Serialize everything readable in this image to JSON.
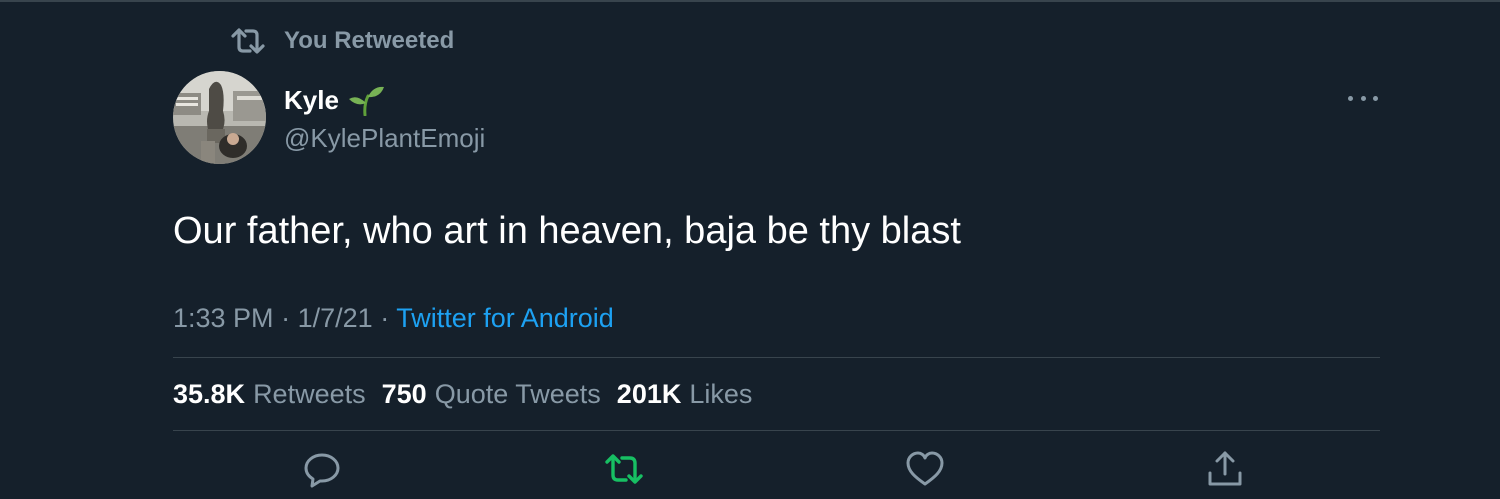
{
  "retweet_context": {
    "text": "You Retweeted",
    "icon": "retweet-icon"
  },
  "author": {
    "name": "Kyle",
    "emoji": "seedling-emoji",
    "handle": "@KylePlantEmoji",
    "avatar": "avatar-photo"
  },
  "tweet": {
    "text": "Our father, who art in heaven, baja be thy blast"
  },
  "meta": {
    "time": "1:33 PM",
    "separator": "·",
    "date": "1/7/21",
    "source": "Twitter for Android"
  },
  "stats": {
    "retweets": {
      "count": "35.8K",
      "label": "Retweets"
    },
    "quotes": {
      "count": "750",
      "label": "Quote Tweets"
    },
    "likes": {
      "count": "201K",
      "label": "Likes"
    }
  },
  "actions": {
    "reply": "reply-icon",
    "retweet": "retweet-icon",
    "like": "heart-icon",
    "share": "share-icon"
  },
  "colors": {
    "background": "#15202b",
    "secondary_text": "#8899a6",
    "link": "#1da1f2",
    "retweet_active": "#17bf63",
    "divider": "#38444d"
  }
}
